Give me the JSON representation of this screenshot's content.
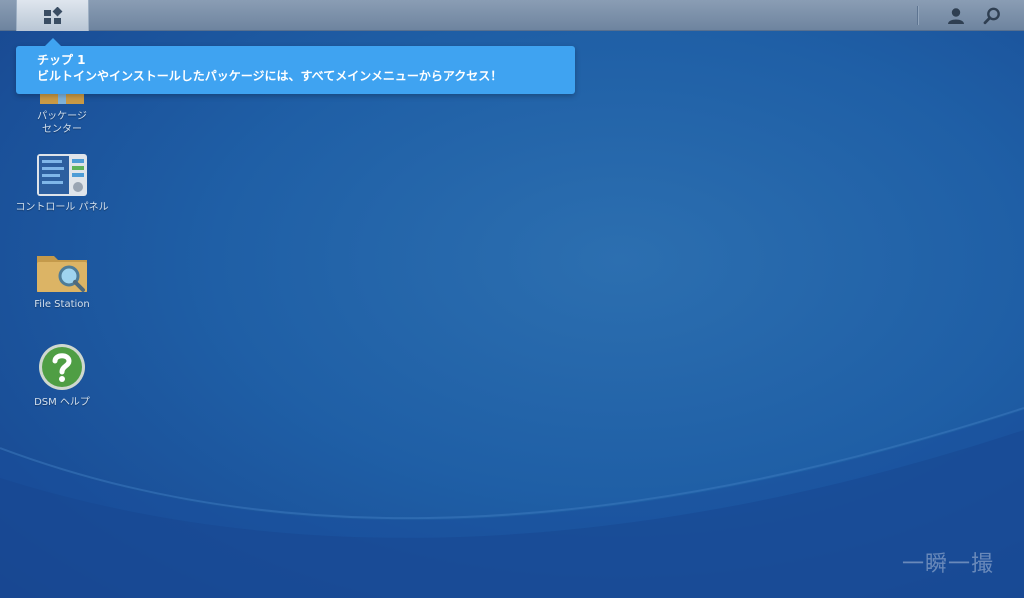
{
  "taskbar": {
    "main_menu_icon": "grid-menu-icon",
    "user_icon": "user-icon",
    "search_icon": "search-icon"
  },
  "tip": {
    "title": "チップ 1",
    "body": "ビルトインやインストールしたパッケージには、すべてメインメニューからアクセス！"
  },
  "desktop": {
    "icons": [
      {
        "label_line1": "パッケージ",
        "label_line2": "センター",
        "icon": "package-center-icon"
      },
      {
        "label_line1": "コントロール パネル",
        "label_line2": "",
        "icon": "control-panel-icon"
      },
      {
        "label_line1": "File Station",
        "label_line2": "",
        "icon": "file-station-icon"
      },
      {
        "label_line1": "DSM ヘルプ",
        "label_line2": "",
        "icon": "help-icon"
      }
    ]
  },
  "watermark": "一瞬一撮",
  "colors": {
    "tip_background": "#3fa3f1",
    "desktop_background": "#1f5fa6"
  }
}
